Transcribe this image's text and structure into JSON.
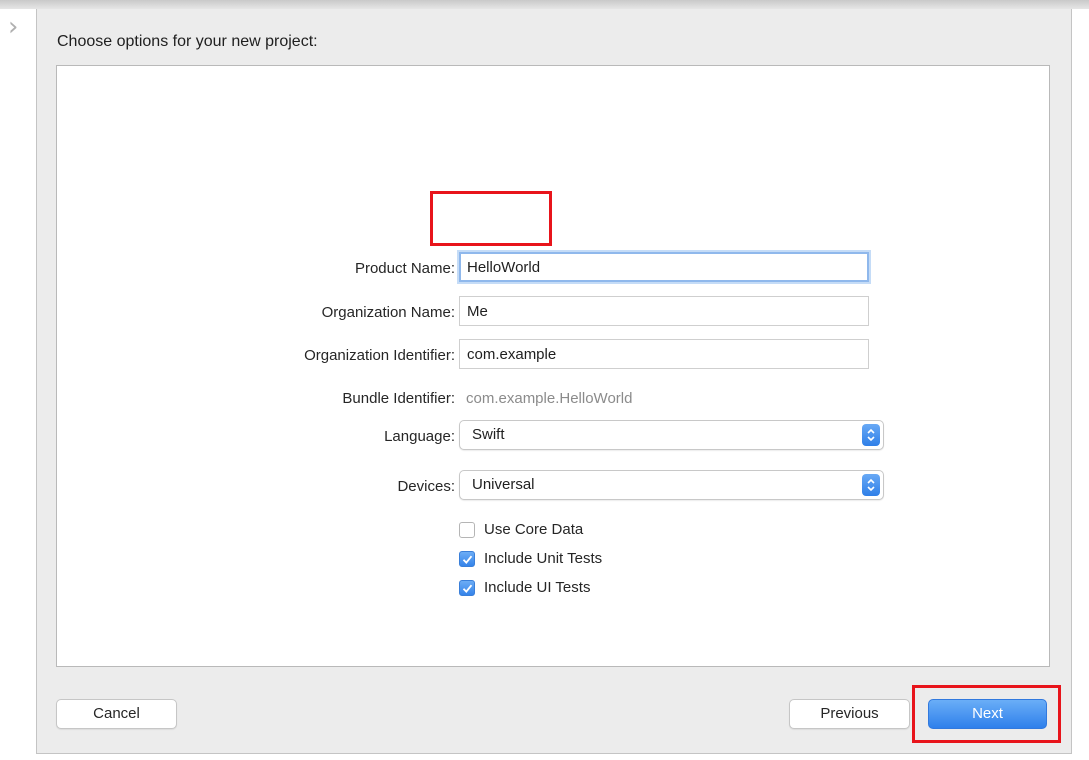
{
  "chrome": {
    "side_chevron": "›"
  },
  "dialog": {
    "title": "Choose options for your new project:",
    "fields": {
      "product_name": {
        "label": "Product Name:",
        "value": "HelloWorld"
      },
      "organization_name": {
        "label": "Organization Name:",
        "value": "Me"
      },
      "organization_identifier": {
        "label": "Organization Identifier:",
        "value": "com.example"
      },
      "bundle_identifier": {
        "label": "Bundle Identifier:",
        "value": "com.example.HelloWorld"
      },
      "language": {
        "label": "Language:",
        "value": "Swift"
      },
      "devices": {
        "label": "Devices:",
        "value": "Universal"
      }
    },
    "checkboxes": [
      {
        "label": "Use Core Data",
        "checked": false
      },
      {
        "label": "Include Unit Tests",
        "checked": true
      },
      {
        "label": "Include UI Tests",
        "checked": true
      }
    ],
    "buttons": {
      "cancel": "Cancel",
      "previous": "Previous",
      "next": "Next"
    }
  },
  "colors": {
    "accent": "#3584ea",
    "highlight": "#e8141b",
    "sheet_background": "#ececec"
  }
}
